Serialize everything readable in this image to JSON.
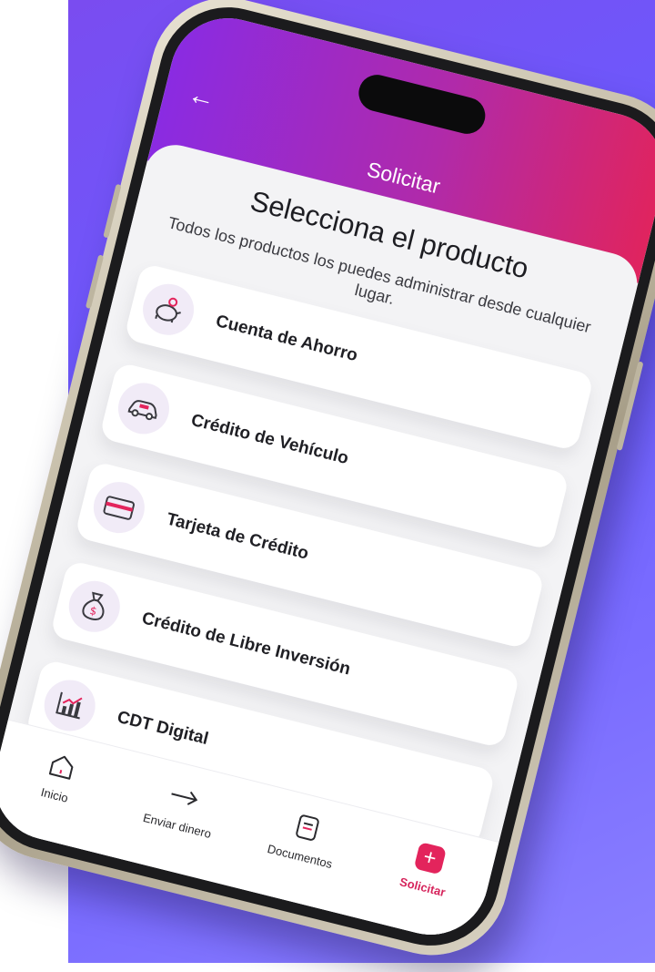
{
  "header": {
    "back_icon": "back-arrow-icon",
    "title": "Solicitar"
  },
  "content": {
    "title": "Selecciona el producto",
    "subtitle": "Todos los productos los puedes administrar desde cualquier lugar."
  },
  "products": [
    {
      "label": "Cuenta de Ahorro",
      "icon": "piggy-bank-icon"
    },
    {
      "label": "Crédito de Vehículo",
      "icon": "car-icon"
    },
    {
      "label": "Tarjeta de Crédito",
      "icon": "credit-card-icon"
    },
    {
      "label": "Crédito de Libre Inversión",
      "icon": "money-bag-icon"
    },
    {
      "label": "CDT Digital",
      "icon": "growth-chart-icon"
    }
  ],
  "tabbar": [
    {
      "label": "Inicio",
      "icon": "home-icon",
      "active": false
    },
    {
      "label": "Enviar dinero",
      "icon": "send-arrow-icon",
      "active": false
    },
    {
      "label": "Documentos",
      "icon": "documents-icon",
      "active": false
    },
    {
      "label": "Solicitar",
      "icon": "plus-icon",
      "active": true
    }
  ],
  "colors": {
    "accent": "#e3245c",
    "header_gradient_start": "#8a2be2",
    "header_gradient_end": "#e0245e",
    "background": "#6a5cff"
  }
}
